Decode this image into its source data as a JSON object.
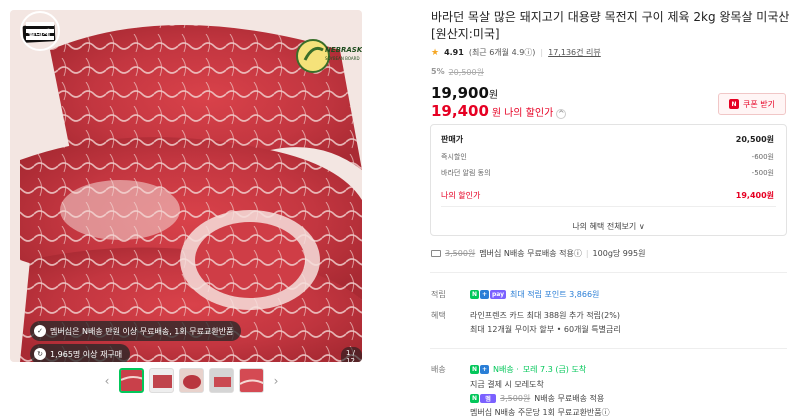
{
  "gallery": {
    "ad_badge": "별대체",
    "logo_nebraska": "NEBRASKA",
    "logo_nebraska_sub": "SOYBEAN BOARD",
    "pill_membership": "멤버십은 N배송 만원 이상 무료배송, 1회 무료교환반품",
    "pill_repurchase": "1,965명 이상 재구매",
    "counter": "1 / 12",
    "prev_icon": "chevron-left-icon",
    "next_icon": "chevron-right-icon",
    "thumbnail_count": 5
  },
  "product": {
    "title": "바라던 목살 많은 돼지고기 대용량 목전지 구이 제육 2kg 왕목살 미국산 [원산지:미국]",
    "rating": "4.91",
    "rating_recent": "(최근 6개월 4.9ⓘ)",
    "review_count": "17,136건 리뷰",
    "discount_pct": "5%",
    "original_price": "20,500원",
    "price": "19,900",
    "price_unit": "원",
    "my_price": "19,400",
    "my_price_unit": "원",
    "my_price_label": "나의 할인가",
    "coupon_label": "쿠폰 받기"
  },
  "breakdown": {
    "rows": [
      {
        "label": "판매가",
        "value": "20,500원"
      },
      {
        "label": "즉시할인",
        "value": "-600원"
      },
      {
        "label": "바라던 알림 동의",
        "value": "-500원"
      }
    ],
    "final_label": "나의 할인가",
    "final_value": "19,400원",
    "benefits_link": "나의 혜택 전체보기 ∨"
  },
  "shipping_summary": {
    "orig": "3,500원",
    "text": "멤버십 N배송 무료배송 적용ⓘ",
    "per_unit": "100g당 995원"
  },
  "info": {
    "points_label": "적립",
    "points_value": "최대 적립 포인트 3,866원",
    "benefit_label": "혜택",
    "benefit_line1": "라인프렌즈 카드 최대 388원 추가 적립(2%)",
    "benefit_line2": "최대 12개월 무이자 할부 • 60개월 특별금리",
    "delivery_label": "배송",
    "delivery_line1": "모레 7.3 (금) 도착",
    "delivery_prefix": "N배송 ·",
    "delivery_line2": "지금 결제 시 모레도착",
    "delivery_line3_orig": "3,500원",
    "delivery_line3": "N배송 무료배송 적용",
    "delivery_line4": "멤버십 N배송 주문당 1회 무료교환반품ⓘ"
  },
  "colors": {
    "accent_red": "#e60023",
    "naver_green": "#03c75a",
    "link_blue": "#2a7ed6"
  }
}
